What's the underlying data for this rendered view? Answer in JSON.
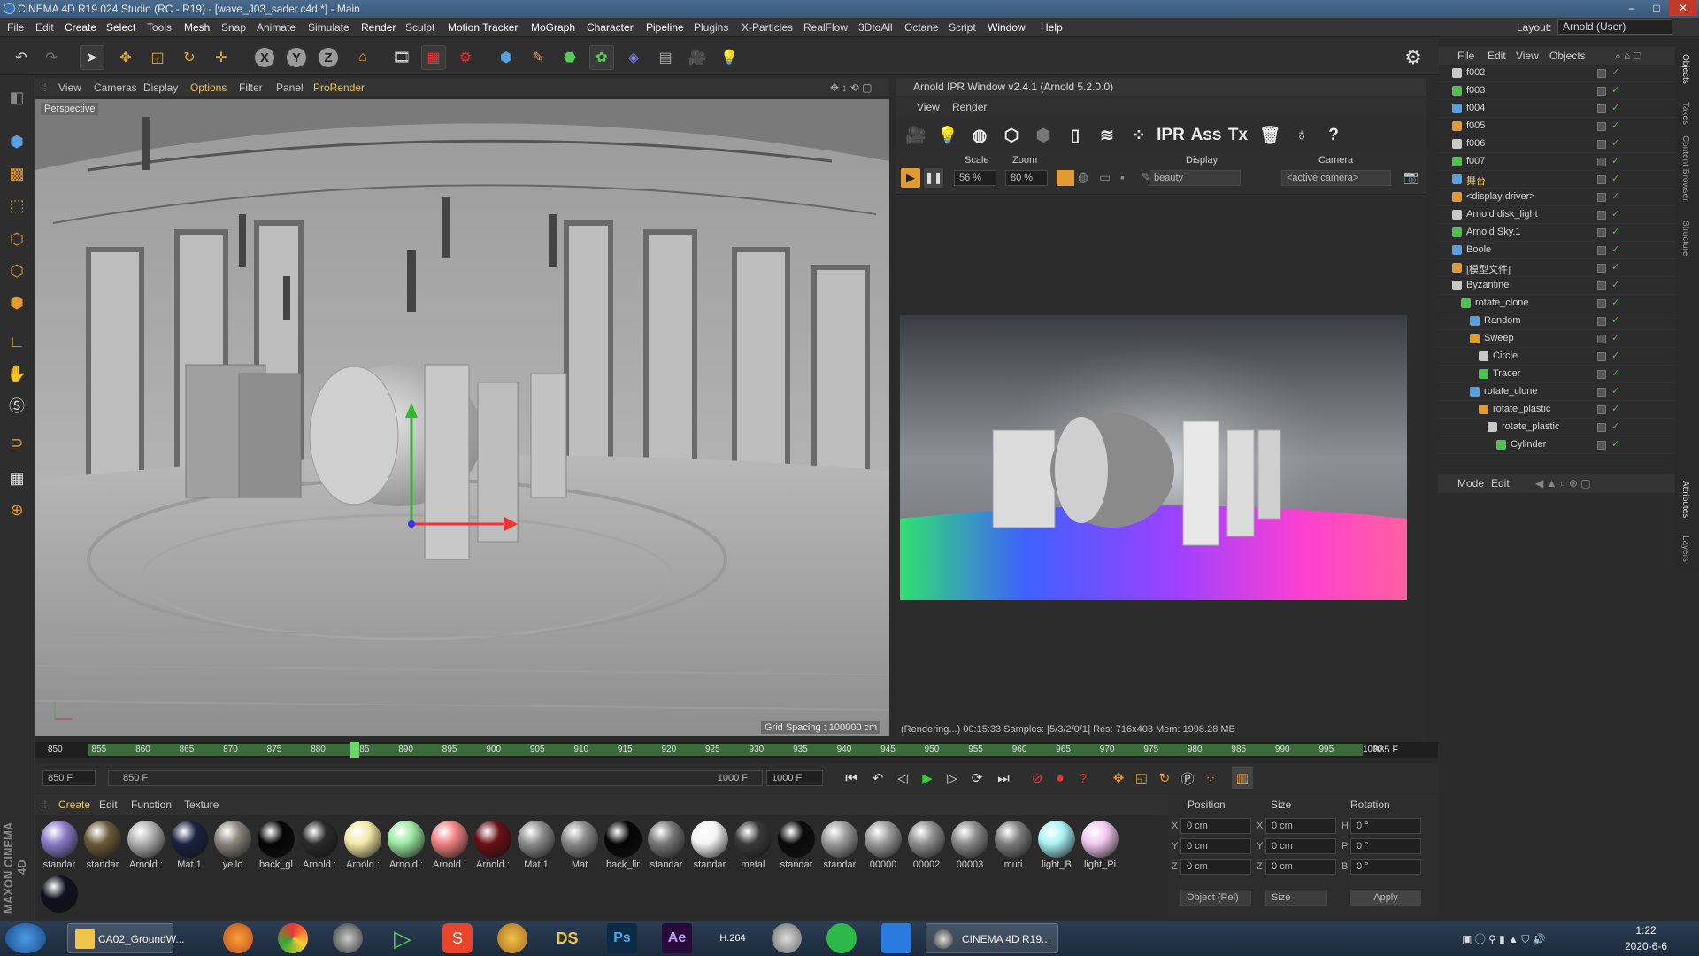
{
  "window": {
    "title": "CINEMA 4D R19.024 Studio (RC - R19) - [wave_J03_sader.c4d *] - Main",
    "layout_label": "Layout:",
    "layout_value": "Arnold (User)"
  },
  "menu": [
    "File",
    "Edit",
    "Create",
    "Select",
    "Tools",
    "Mesh",
    "Snap",
    "Animate",
    "Simulate",
    "Render",
    "Sculpt",
    "Motion Tracker",
    "MoGraph",
    "Character",
    "Pipeline",
    "Plugins",
    "X-Particles",
    "RealFlow",
    "3DtoAll",
    "Octane",
    "Script",
    "Window",
    "Help"
  ],
  "viewport": {
    "menu": [
      "View",
      "Cameras",
      "Display",
      "Options",
      "Filter",
      "Panel",
      "ProRender"
    ],
    "camera_label": "Perspective",
    "grid_spacing": "Grid Spacing : 100000 cm"
  },
  "ipr": {
    "title": "Arnold IPR Window v2.4.1 (Arnold 5.2.0.0)",
    "menu": [
      "View",
      "Render"
    ],
    "toolbar_text": [
      "IPR",
      "Ass",
      "Tx",
      "?"
    ],
    "scale_label": "Scale",
    "scale_value": "56 %",
    "zoom_label": "Zoom",
    "zoom_value": "80 %",
    "display_label": "Display",
    "display_value": "beauty",
    "camera_label": "Camera",
    "camera_value": "<active camera>",
    "status": "(Rendering...) 00:15:33  Samples: [5/3/2/0/1]  Res: 716x403  Mem: 1998.28 MB"
  },
  "objects_panel": {
    "menu": [
      "File",
      "Edit",
      "View",
      "Objects"
    ],
    "items": [
      {
        "name": "f002",
        "indent": 0
      },
      {
        "name": "f003",
        "indent": 0
      },
      {
        "name": "f004",
        "indent": 0
      },
      {
        "name": "f005",
        "indent": 0
      },
      {
        "name": "f006",
        "indent": 0
      },
      {
        "name": "f007",
        "indent": 0
      },
      {
        "name": "舞台",
        "indent": 0
      },
      {
        "name": "<display driver>",
        "indent": 0
      },
      {
        "name": "Arnold disk_light",
        "indent": 0
      },
      {
        "name": "Arnold Sky.1",
        "indent": 0
      },
      {
        "name": "Boole",
        "indent": 0
      },
      {
        "name": "[模型文件]",
        "indent": 0
      },
      {
        "name": "Byzantine",
        "indent": 0
      },
      {
        "name": "rotate_clone",
        "indent": 1
      },
      {
        "name": "Random",
        "indent": 2
      },
      {
        "name": "Sweep",
        "indent": 2
      },
      {
        "name": "Circle",
        "indent": 3
      },
      {
        "name": "Tracer",
        "indent": 3
      },
      {
        "name": "rotate_clone",
        "indent": 2
      },
      {
        "name": "rotate_plastic",
        "indent": 3
      },
      {
        "name": "rotate_plastic",
        "indent": 4
      },
      {
        "name": "Cylinder",
        "indent": 5
      }
    ]
  },
  "attributes_panel": {
    "menu": [
      "Mode",
      "Edit"
    ]
  },
  "timeline": {
    "ticks": [
      "850",
      "855",
      "860",
      "865",
      "870",
      "875",
      "880",
      "885",
      "890",
      "895",
      "900",
      "905",
      "910",
      "915",
      "920",
      "925",
      "930",
      "935",
      "940",
      "945",
      "950",
      "955",
      "960",
      "965",
      "970",
      "975",
      "980",
      "985",
      "990",
      "995",
      "1000"
    ],
    "current_frame": "885",
    "end_field": "885 F",
    "start_field": "850 F",
    "range_start": "850 F",
    "range_end": "1000 F",
    "max_field": "1000 F"
  },
  "materials": {
    "menu": [
      "Create",
      "Edit",
      "Function",
      "Texture"
    ],
    "items": [
      {
        "name": "standar",
        "color": "#8a7cc8"
      },
      {
        "name": "standar",
        "color": "#6a5a3a"
      },
      {
        "name": "Arnold :",
        "color": "#b0b0b0"
      },
      {
        "name": "Mat.1",
        "color": "#1a2240"
      },
      {
        "name": "yello",
        "color": "#8a857a"
      },
      {
        "name": "back_gl",
        "color": "#050505"
      },
      {
        "name": "Arnold :",
        "color": "#2a2a2a"
      },
      {
        "name": "Arnold :",
        "color": "#f4e9a6"
      },
      {
        "name": "Arnold :",
        "color": "#9be8a0"
      },
      {
        "name": "Arnold :",
        "color": "#f08080"
      },
      {
        "name": "Arnold :",
        "color": "#6a0f14"
      },
      {
        "name": "Mat.1",
        "color": "#8c8c8c"
      },
      {
        "name": "Mat",
        "color": "#8a8a8a"
      },
      {
        "name": "back_lir",
        "color": "#050505"
      },
      {
        "name": "standar",
        "color": "#777777"
      },
      {
        "name": "standar",
        "color": "#f4f4f4"
      },
      {
        "name": "metal",
        "color": "#3a3a3a"
      },
      {
        "name": "standar",
        "color": "#0a0a0a"
      },
      {
        "name": "standar",
        "color": "#9a9a9a"
      },
      {
        "name": "00000",
        "color": "#9a9a9a"
      },
      {
        "name": "00002",
        "color": "#8e8e8e"
      },
      {
        "name": "00003",
        "color": "#8a8a8a"
      },
      {
        "name": "muti",
        "color": "#7e7e7e"
      },
      {
        "name": "light_B",
        "color": "#a8f2f4"
      },
      {
        "name": "light_Pi",
        "color": "#f4c8f0"
      },
      {
        "name": "",
        "color": "#101020"
      }
    ]
  },
  "coordinates": {
    "headers": [
      "Position",
      "Size",
      "Rotation"
    ],
    "rows": [
      {
        "axis": "X",
        "pos": "0 cm",
        "size_axis": "X",
        "size": "0 cm",
        "rot_axis": "H",
        "rot": "0 °"
      },
      {
        "axis": "Y",
        "pos": "0 cm",
        "size_axis": "Y",
        "size": "0 cm",
        "rot_axis": "P",
        "rot": "0 °"
      },
      {
        "axis": "Z",
        "pos": "0 cm",
        "size_axis": "Z",
        "size": "0 cm",
        "rot_axis": "B",
        "rot": "0 °"
      }
    ],
    "mode_value": "Object (Rel)",
    "size_mode_value": "Size",
    "apply_label": "Apply"
  },
  "side_tabs": [
    "Objects",
    "Takes",
    "Content Browser",
    "Structure",
    "Attributes",
    "Layers"
  ],
  "maxon_logo": "MAXON CINEMA 4D",
  "taskbar": {
    "items": [
      "CA02_GroundW...",
      "",
      "",
      "",
      "",
      "",
      "",
      "DS",
      "Ps",
      "Ae",
      "H.264",
      "",
      "",
      "",
      "CINEMA 4D R19..."
    ],
    "time": "1:22",
    "date": "2020-6-6"
  },
  "colors": {
    "accent": "#e29a32",
    "timeline_green": "#3b6b3b",
    "check_green": "#4ec24e"
  }
}
